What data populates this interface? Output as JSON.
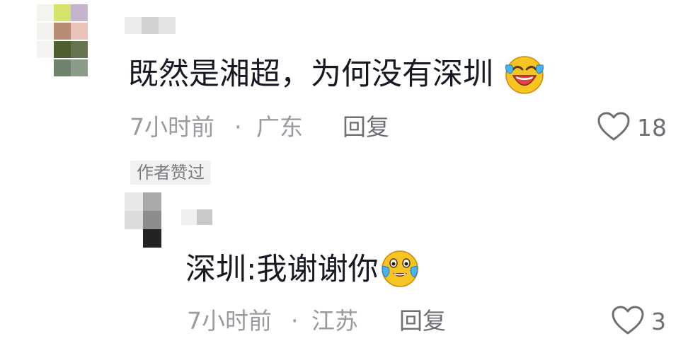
{
  "comment": {
    "text": "既然是湘超，为何没有深圳",
    "emoji_icon": "grinning-squinting-tears-emoji",
    "time": "7小时前",
    "separator": "·",
    "location": "广东",
    "reply_label": "回复",
    "like_count": "18",
    "badge": "作者赞过"
  },
  "reply": {
    "text": "深圳:我谢谢你",
    "emoji_icon": "tearful-grin-emoji",
    "time": "7小时前",
    "separator": "·",
    "location": "江苏",
    "reply_label": "回复",
    "like_count": "3"
  },
  "colors": {
    "text": "#161823",
    "meta": "#9a9aa0",
    "badge_bg": "#f1f1f2",
    "emoji_yellow": "#f7c521"
  }
}
